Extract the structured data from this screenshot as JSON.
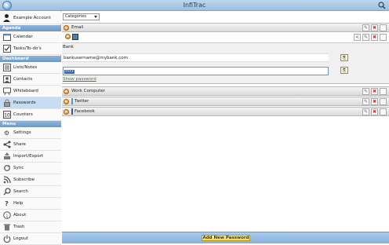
{
  "app": {
    "title": "InfiTrac"
  },
  "account": {
    "label": "Example Account"
  },
  "sidebar": {
    "sections": [
      {
        "header": "Agenda",
        "items": [
          {
            "label": "Calendar",
            "icon": "calendar-icon"
          },
          {
            "label": "Tasks/To-do's",
            "icon": "tasks-icon"
          }
        ]
      },
      {
        "header": "Dashboard",
        "items": [
          {
            "label": "Lists/Notes",
            "icon": "notes-icon"
          },
          {
            "label": "Contacts",
            "icon": "contacts-icon"
          },
          {
            "label": "Whiteboard",
            "icon": "whiteboard-icon"
          },
          {
            "label": "Passwords",
            "icon": "lock-icon"
          },
          {
            "label": "Counters",
            "icon": "counter-icon"
          }
        ]
      },
      {
        "header": "Menu",
        "items": [
          {
            "label": "Settings",
            "icon": "gear-icon"
          },
          {
            "label": "Share",
            "icon": "share-icon"
          },
          {
            "label": "Import/Export",
            "icon": "import-export-icon"
          },
          {
            "label": "Sync",
            "icon": "sync-icon"
          },
          {
            "label": "Subscribe",
            "icon": "rss-icon"
          },
          {
            "label": "Search",
            "icon": "search-icon"
          },
          {
            "label": "Help",
            "icon": "help-icon"
          },
          {
            "label": "About",
            "icon": "info-icon"
          },
          {
            "label": "Trash",
            "icon": "trash-icon"
          },
          {
            "label": "Logout",
            "icon": "power-icon"
          }
        ]
      }
    ],
    "active_item": "Passwords"
  },
  "filter": {
    "category_value": "Categories"
  },
  "groups": [
    {
      "label": "Email",
      "expanded": true
    },
    {
      "label": "Work Computer",
      "color": "#4a4a4a"
    },
    {
      "label": "Twitter",
      "color": "#4a9ad4"
    },
    {
      "label": "Facebook",
      "color": "#3b5998"
    }
  ],
  "entry": {
    "name": "Bank",
    "username": "bankusername@mybank.com",
    "password_mask": "••••",
    "show_password": "Show password",
    "color": "#4f7dad"
  },
  "bottom": {
    "add_label": "Add New Password"
  }
}
